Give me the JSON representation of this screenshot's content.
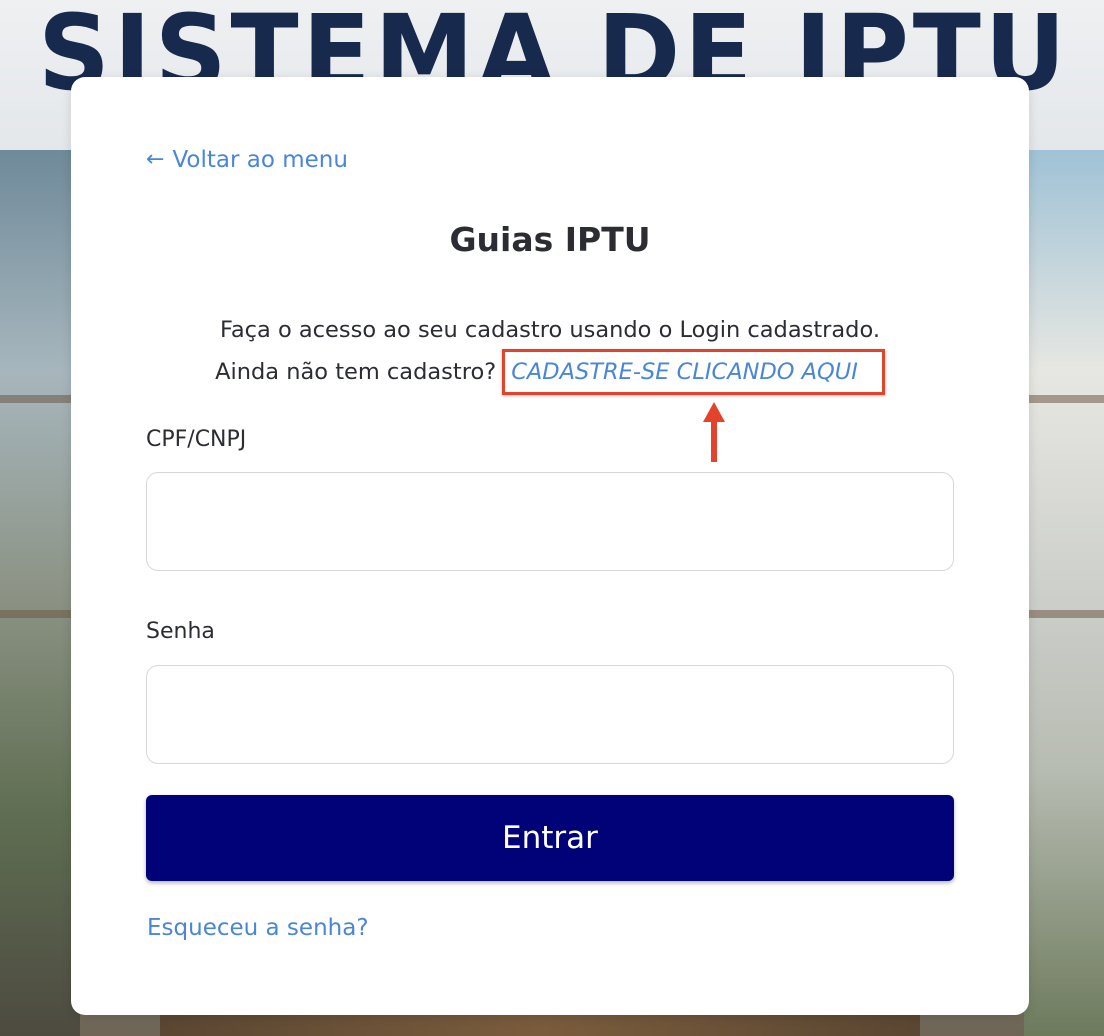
{
  "background": {
    "title": "SISTEMA DE IPTU"
  },
  "card": {
    "back_link": "Voltar ao menu",
    "back_icon": "arrow-left-icon",
    "title": "Guias IPTU",
    "description_line1": "Faça o acesso ao seu cadastro usando o Login cadastrado.",
    "description_line2": "Ainda não tem cadastro?",
    "signup_link": "CADASTRE-SE CLICANDO AQUI",
    "cpf_label": "CPF/CNPJ",
    "cpf_value": "",
    "password_label": "Senha",
    "password_value": "",
    "submit_label": "Entrar",
    "forgot_link": "Esqueceu a senha?"
  },
  "annotation": {
    "highlight_color": "#e2432a",
    "arrow_icon": "arrow-up-icon"
  },
  "colors": {
    "link": "#4a86d8",
    "button": "#020278"
  }
}
